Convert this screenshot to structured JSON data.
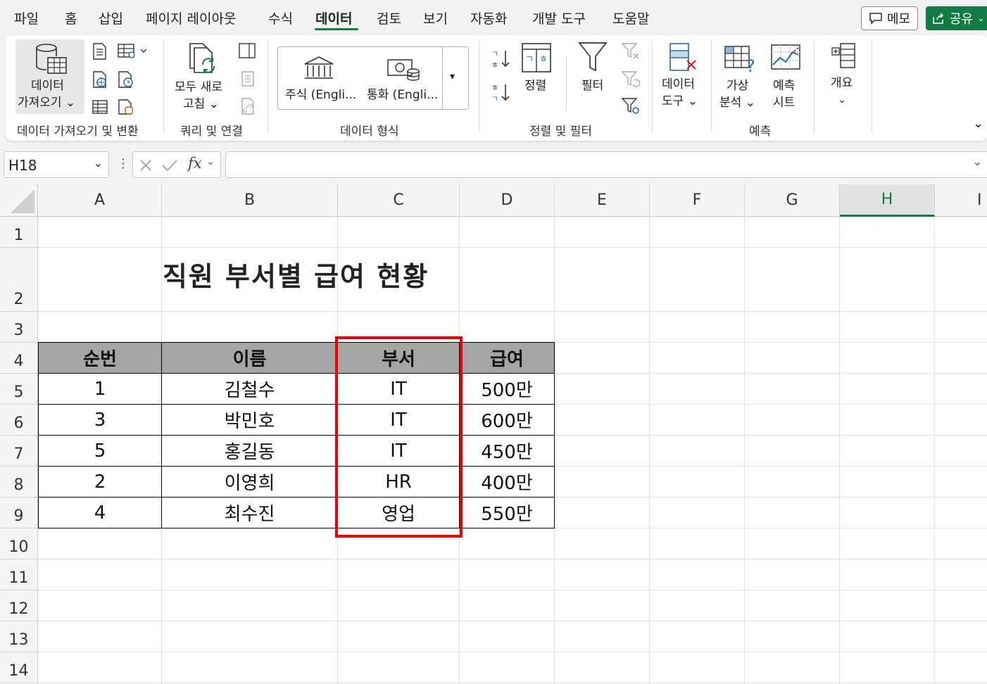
{
  "menu": {
    "tabs": [
      "파일",
      "홈",
      "삽입",
      "페이지 레이아웃",
      "수식",
      "데이터",
      "검토",
      "보기",
      "자동화",
      "개발 도구",
      "도움말"
    ],
    "active": "데이터",
    "memo_label": "메모",
    "share_label": "공유"
  },
  "ribbon": {
    "get_data_line1": "데이터",
    "get_data_line2": "가져오기",
    "refresh_line1": "모두 새로",
    "refresh_line2": "고침",
    "stocks": "주식 (Engli...",
    "currency": "통화 (Engli...",
    "sort": "정렬",
    "filter": "필터",
    "data_tools_line1": "데이터",
    "data_tools_line2": "도구",
    "whatif_line1": "가상",
    "whatif_line2": "분석",
    "forecast_line1": "예측",
    "forecast_line2": "시트",
    "outline": "개요",
    "groups": {
      "get_transform": "데이터 가져오기 및 변환",
      "queries": "쿼리 및 연결",
      "data_types": "데이터 형식",
      "sort_filter": "정렬 및 필터",
      "forecast": "예측"
    }
  },
  "formula_bar": {
    "name_box": "H18",
    "formula": ""
  },
  "sheet": {
    "columns": [
      "A",
      "B",
      "C",
      "D",
      "E",
      "F",
      "G",
      "H",
      "I"
    ],
    "selected_column": "H",
    "rows": [
      "1",
      "2",
      "3",
      "4",
      "5",
      "6",
      "7",
      "8",
      "9",
      "10",
      "11",
      "12",
      "13",
      "14"
    ],
    "title": "직원 부서별 급여 현황",
    "table": {
      "headers": [
        "순번",
        "이름",
        "부서",
        "급여"
      ],
      "rows": [
        [
          "1",
          "김철수",
          "IT",
          "500만"
        ],
        [
          "3",
          "박민호",
          "IT",
          "600만"
        ],
        [
          "5",
          "홍길동",
          "IT",
          "450만"
        ],
        [
          "2",
          "이영희",
          "HR",
          "400만"
        ],
        [
          "4",
          "최수진",
          "영업",
          "550만"
        ]
      ]
    },
    "highlight_color": "#ee0000",
    "header_fill": "#a5a5a5",
    "accent": "#107c41"
  }
}
